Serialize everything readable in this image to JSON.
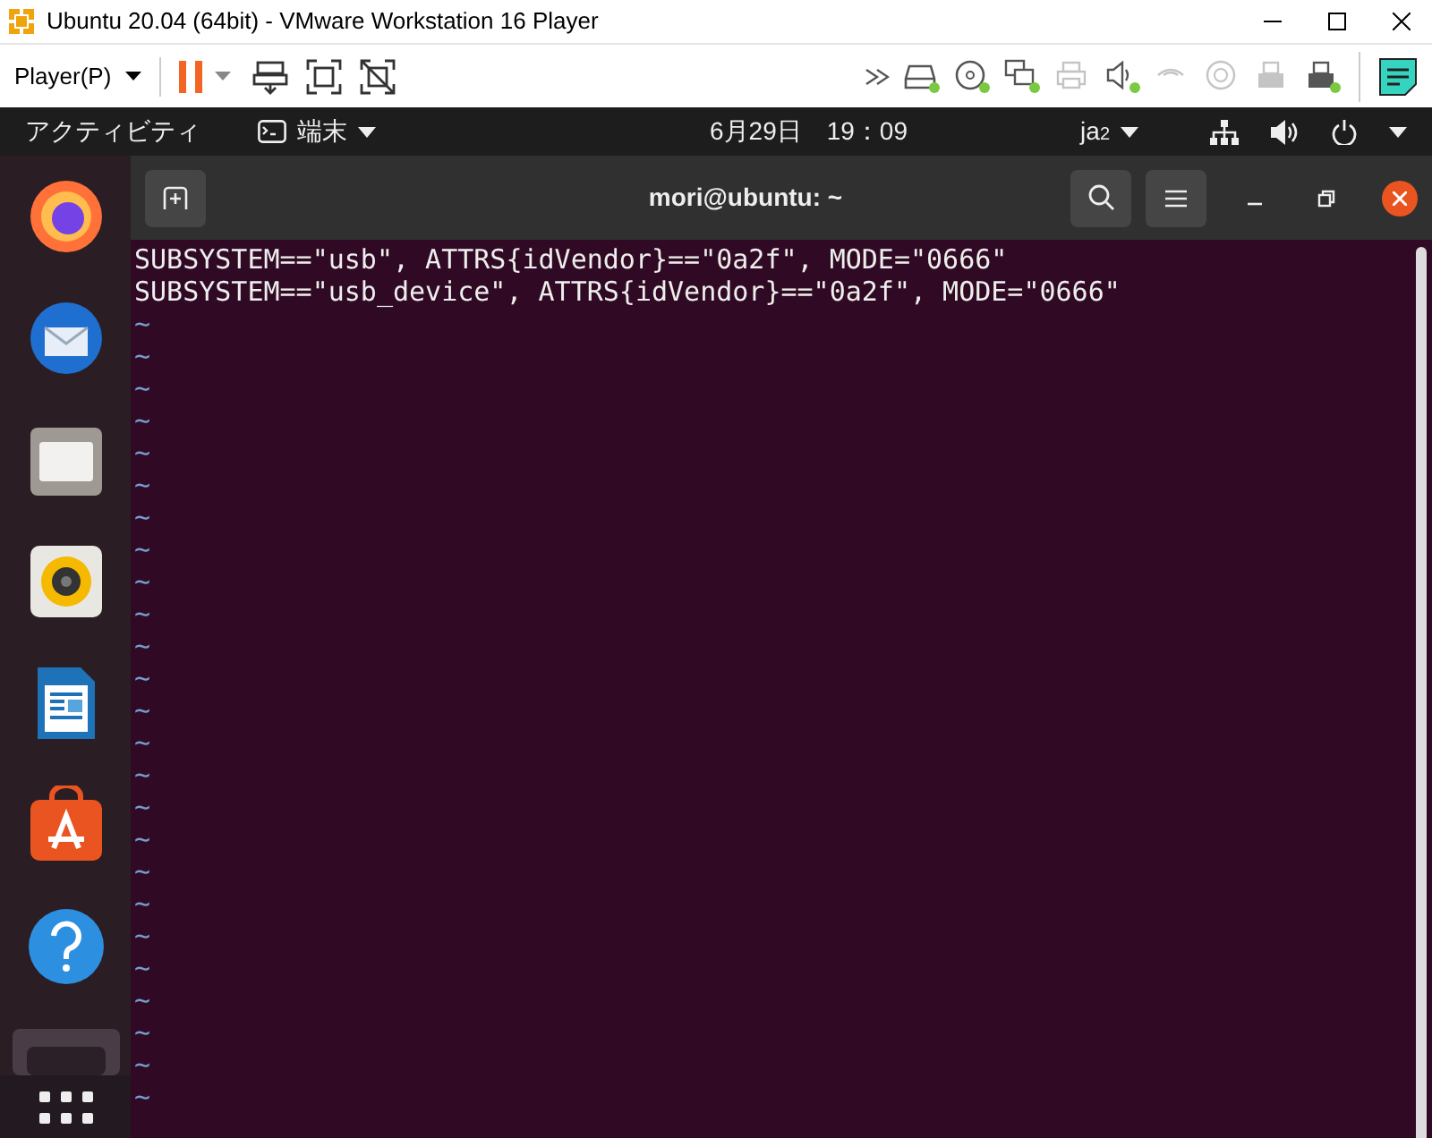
{
  "window": {
    "title": "Ubuntu 20.04 (64bit) - VMware Workstation 16 Player"
  },
  "toolbar": {
    "player_menu": "Player(P)",
    "paused": true,
    "devices": [
      {
        "kind": "disk",
        "connected": true
      },
      {
        "kind": "cd",
        "connected": true
      },
      {
        "kind": "network",
        "connected": true
      },
      {
        "kind": "printer",
        "connected": false
      },
      {
        "kind": "sound",
        "connected": true
      },
      {
        "kind": "camera",
        "connected": false
      },
      {
        "kind": "disc",
        "connected": false
      },
      {
        "kind": "usb",
        "connected": false
      },
      {
        "kind": "usb",
        "connected": true
      }
    ]
  },
  "top_bar": {
    "activities": "アクティビティ",
    "app_menu": "端末",
    "clock": "6月29日　19：09",
    "input_method": "ja",
    "input_method_sub": "2"
  },
  "dock": {
    "apps": [
      {
        "kind": "firefox"
      },
      {
        "kind": "thunderbird"
      },
      {
        "kind": "files"
      },
      {
        "kind": "rhythmbox"
      },
      {
        "kind": "writer"
      },
      {
        "kind": "software"
      },
      {
        "kind": "help"
      },
      {
        "kind": "terminal"
      }
    ]
  },
  "terminal": {
    "title": "mori@ubuntu: ~",
    "lines": [
      "SUBSYSTEM==\"usb\", ATTRS{idVendor}==\"0a2f\", MODE=\"0666\"",
      "SUBSYSTEM==\"usb_device\", ATTRS{idVendor}==\"0a2f\", MODE=\"0666\""
    ],
    "empty_lines": [
      "~",
      "~",
      "~",
      "~",
      "~",
      "~",
      "~",
      "~",
      "~",
      "~",
      "~",
      "~",
      "~",
      "~",
      "~",
      "~",
      "~",
      "~",
      "~",
      "~",
      "~",
      "~",
      "~",
      "~",
      "~"
    ]
  }
}
